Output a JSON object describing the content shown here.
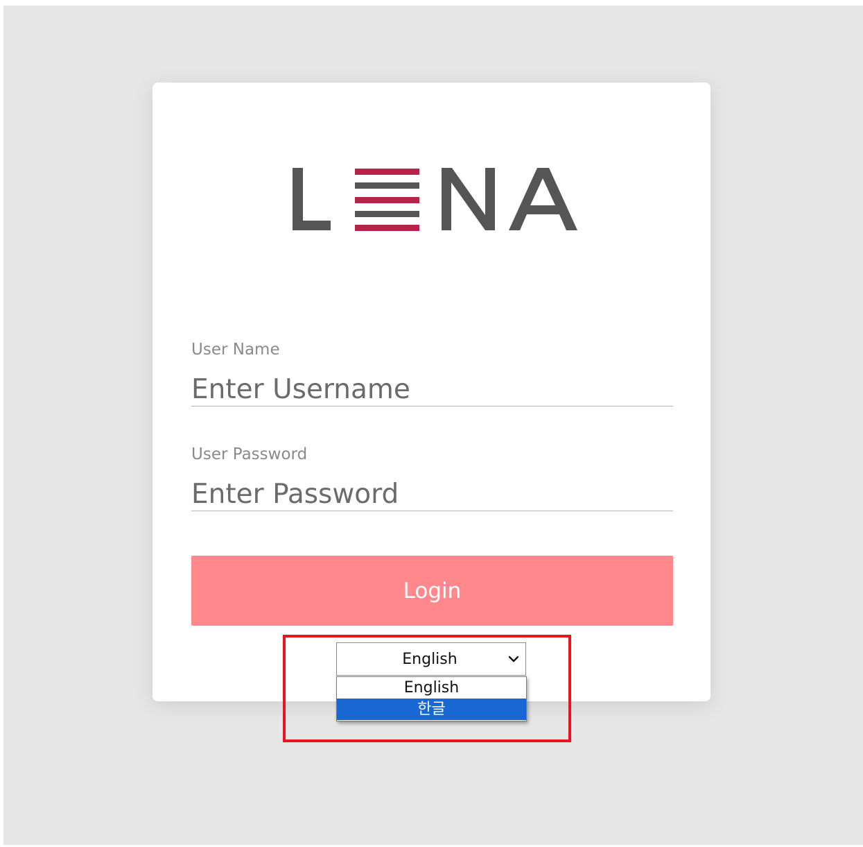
{
  "brand": {
    "logo_text": "LENA",
    "stripe_colors": [
      "#b8234a",
      "#555555",
      "#b8234a",
      "#555555",
      "#b8234a"
    ],
    "letter_color": "#555555"
  },
  "form": {
    "username": {
      "label": "User Name",
      "placeholder": "Enter Username",
      "value": ""
    },
    "password": {
      "label": "User Password",
      "placeholder": "Enter Password",
      "value": ""
    },
    "login_label": "Login"
  },
  "language_select": {
    "selected": "English",
    "options": [
      "English",
      "한글"
    ],
    "highlighted_option": "한글"
  },
  "colors": {
    "background": "#e6e6e6",
    "login_button": "#ff888d",
    "option_highlight": "#1967d2",
    "annotation_box": "#e8141e"
  }
}
